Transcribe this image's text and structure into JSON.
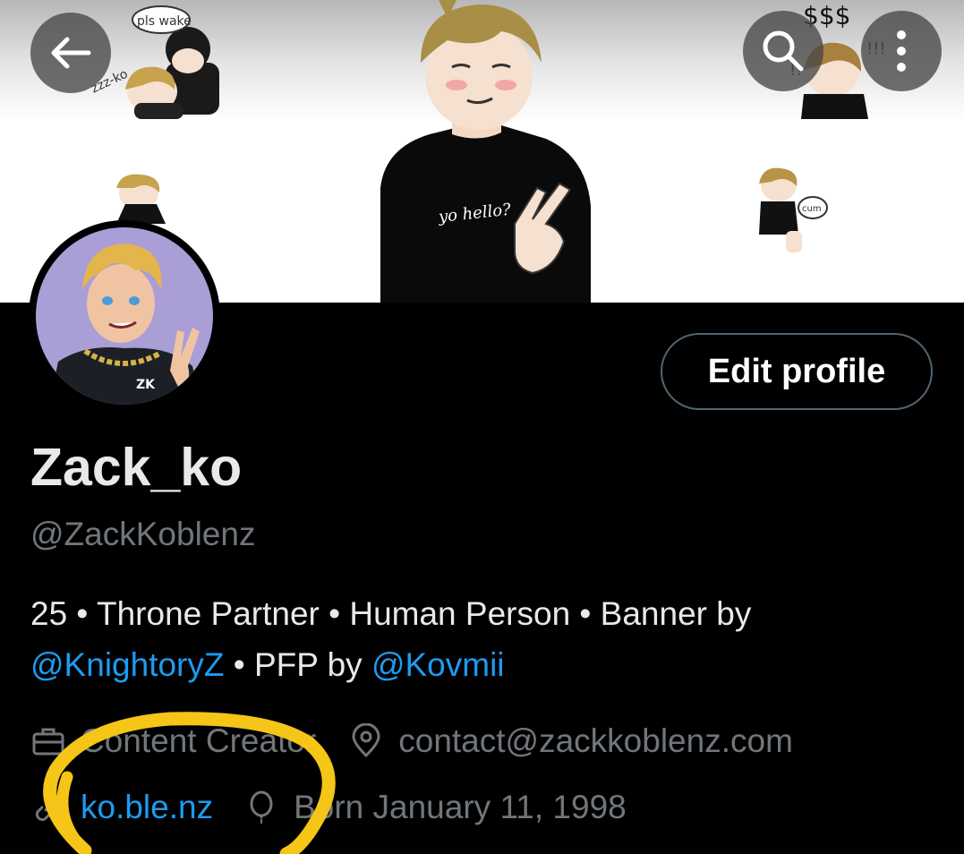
{
  "header": {
    "back_icon": "arrow-left-icon",
    "search_icon": "search-icon",
    "more_icon": "more-vertical-icon"
  },
  "banner": {
    "texts": {
      "speech_top": "pls wake",
      "sleep": "zzz-ko",
      "money": "$$$",
      "shout": "!!!",
      "exclaim": "!!",
      "hoodie_text": "yo hello?",
      "bubble": "cum"
    }
  },
  "avatar": {
    "shirt_text": "ZK"
  },
  "profile": {
    "edit_label": "Edit profile",
    "display_name": "Zack_ko",
    "handle": "@ZackKoblenz",
    "bio": {
      "part1": "25 • Throne Partner • Human Person •  Banner by ",
      "mention1": "@KnightoryZ",
      "part2": " • PFP by ",
      "mention2": "@Kovmii"
    },
    "meta": {
      "category": "Content Creator",
      "location": "contact@zackkoblenz.com",
      "website": "ko.ble.nz",
      "birth": "Born January 11, 1998"
    }
  },
  "colors": {
    "accent": "#1d9bf0",
    "secondary_text": "#71767b",
    "highlight_marker": "#f5c518"
  }
}
